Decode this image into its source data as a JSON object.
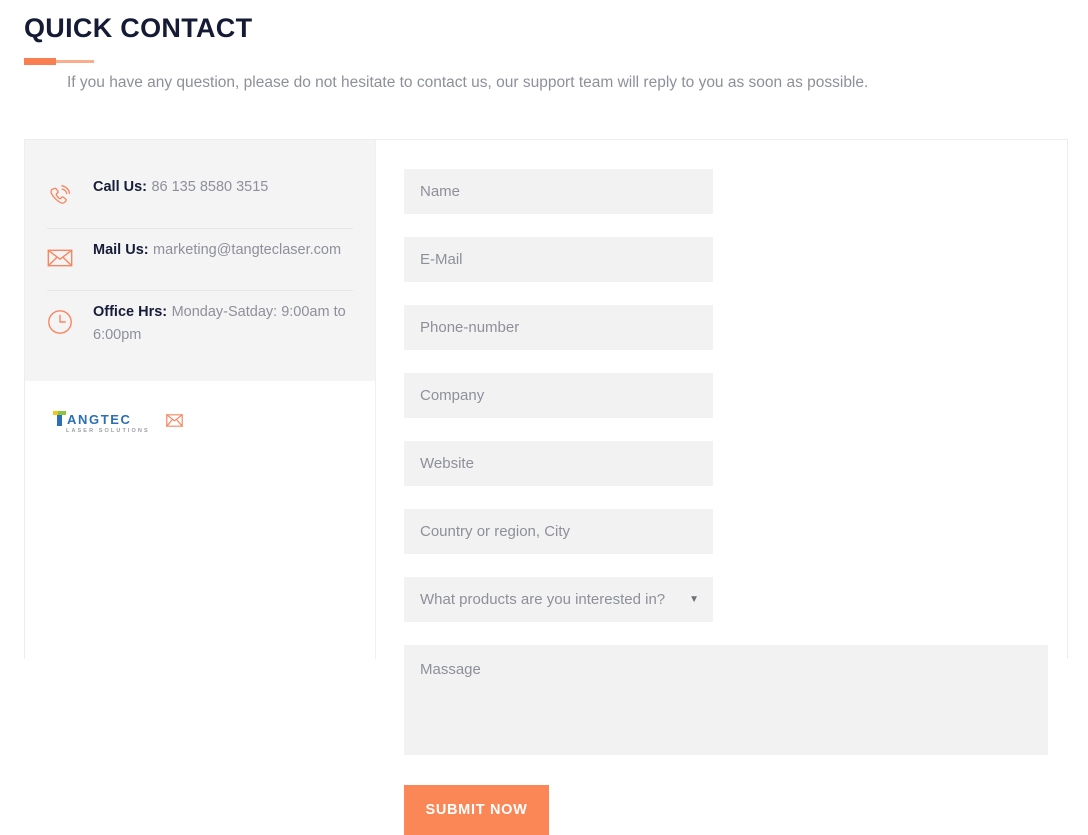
{
  "header": {
    "title": "QUICK CONTACT",
    "subtitle": "If you have any question, please do not hesitate to contact us, our support team will reply to you as soon as possible.",
    "accent_color_dark": "#f97f50",
    "accent_color_light": "#f9ad8a"
  },
  "contact_info": {
    "items": [
      {
        "icon": "phone-icon",
        "label": "Call Us:",
        "value": "86 135 8580 3515"
      },
      {
        "icon": "mail-icon",
        "label": "Mail Us:",
        "value": "marketing@tangteclaser.com"
      },
      {
        "icon": "clock-icon",
        "label": "Office Hrs:",
        "value": "Monday-Satday: 9:00am to 6:00pm"
      }
    ]
  },
  "brand": {
    "wordmark": "ANGTEC",
    "tagline": "LASER SOLUTIONS",
    "mail_icon": "envelope-icon",
    "colors": {
      "text": "#2b6fb5",
      "accent_yellow": "#f5c518",
      "accent_green": "#8cc63e"
    }
  },
  "form": {
    "fields": [
      {
        "name": "name",
        "placeholder": "Name"
      },
      {
        "name": "email",
        "placeholder": "E-Mail"
      },
      {
        "name": "phone",
        "placeholder": "Phone-number"
      },
      {
        "name": "company",
        "placeholder": "Company"
      },
      {
        "name": "website",
        "placeholder": "Website"
      },
      {
        "name": "country",
        "placeholder": "Country or region, City"
      }
    ],
    "product_select": {
      "selected": "What products are you interested in?",
      "caret": "▼"
    },
    "message": {
      "placeholder": "Massage"
    },
    "submit_label": "SUBMIT NOW",
    "submit_color": "#fb8656"
  }
}
